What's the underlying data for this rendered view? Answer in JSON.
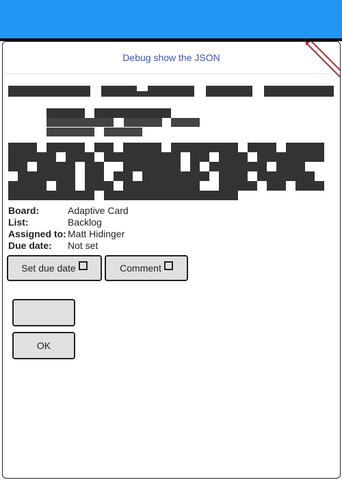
{
  "debug": {
    "link_label": "Debug show the JSON"
  },
  "facts": [
    {
      "title": "Board:",
      "value": "Adaptive Card"
    },
    {
      "title": "List:",
      "value": "Backlog"
    },
    {
      "title": "Assigned to:",
      "value": "Matt Hidinger"
    },
    {
      "title": "Due date:",
      "value": "Not set"
    }
  ],
  "actions": {
    "set_due_date_label": "Set due date",
    "comment_label": "Comment",
    "blank_label": "",
    "ok_label": "OK"
  },
  "colors": {
    "appbar": "#2196f3",
    "link": "#3f51b5",
    "button_bg": "#e0e0e0"
  }
}
